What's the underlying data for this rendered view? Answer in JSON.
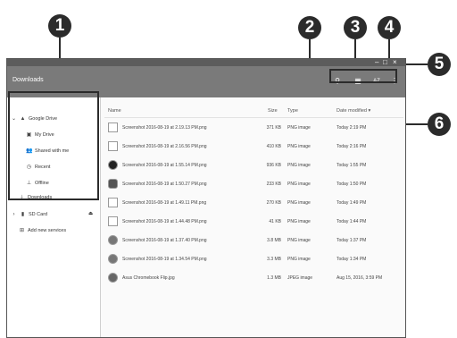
{
  "callouts": [
    "1",
    "2",
    "3",
    "4",
    "5",
    "6"
  ],
  "window": {
    "title": "Downloads",
    "controls": {
      "minimize": "–",
      "maximize": "□",
      "close": "×"
    },
    "toolbar_icons": {
      "search": "⚲",
      "grid_view": "▦",
      "sort": "AZ",
      "menu": "⋮"
    }
  },
  "sidebar": {
    "google_drive": "Google Drive",
    "my_drive": "My Drive",
    "shared_with_me": "Shared with me",
    "recent": "Recent",
    "offline": "Offline",
    "downloads": "Downloads",
    "sd_card": "SD Card",
    "add_services": "Add new services",
    "eject": "⏏"
  },
  "table": {
    "headers": {
      "name": "Name",
      "size": "Size",
      "type": "Type",
      "date": "Date modified ▾"
    },
    "rows": [
      {
        "name": "Screenshot 2016-08-19 at 2.19.13 PM.png",
        "size": "371 KB",
        "type": "PNG image",
        "date": "Today 2:19 PM"
      },
      {
        "name": "Screenshot 2016-08-19 at 2.16.56 PM.png",
        "size": "410 KB",
        "type": "PNG image",
        "date": "Today 2:16 PM"
      },
      {
        "name": "Screenshot 2016-08-19 at 1.55.14 PM.png",
        "size": "936 KB",
        "type": "PNG image",
        "date": "Today 1:55 PM"
      },
      {
        "name": "Screenshot 2016-08-19 at 1.50.27 PM.png",
        "size": "233 KB",
        "type": "PNG image",
        "date": "Today 1:50 PM"
      },
      {
        "name": "Screenshot 2016-08-19 at 1.49.11 PM.png",
        "size": "270 KB",
        "type": "PNG image",
        "date": "Today 1:49 PM"
      },
      {
        "name": "Screenshot 2016-08-19 at 1.44.48 PM.png",
        "size": "41 KB",
        "type": "PNG image",
        "date": "Today 1:44 PM"
      },
      {
        "name": "Screenshot 2016-08-19 at 1.37.40 PM.png",
        "size": "3.8 MB",
        "type": "PNG image",
        "date": "Today 1:37 PM"
      },
      {
        "name": "Screenshot 2016-08-19 at 1.34.54 PM.png",
        "size": "3.3 MB",
        "type": "PNG image",
        "date": "Today 1:34 PM"
      },
      {
        "name": "Asus Chromebook Flip.jpg",
        "size": "1.3 MB",
        "type": "JPEG image",
        "date": "Aug 15, 2016, 3:59 PM"
      }
    ]
  }
}
